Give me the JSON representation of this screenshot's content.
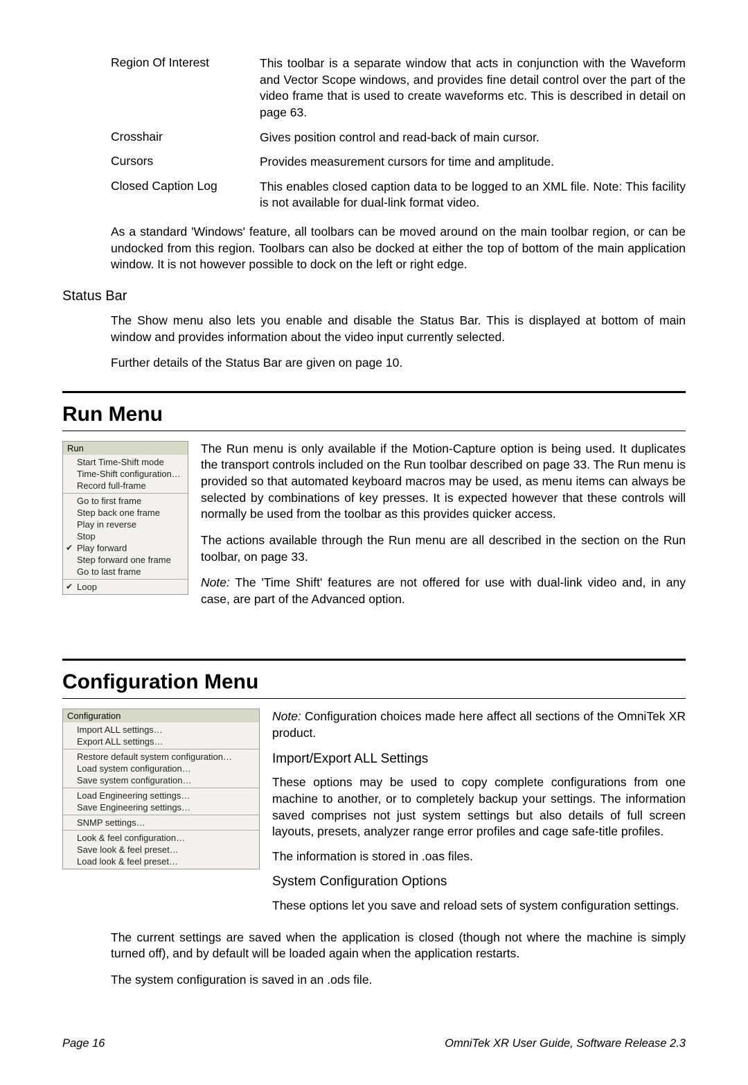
{
  "toolbars": [
    {
      "label": "Region Of Interest",
      "desc": "This toolbar is a separate window that acts in conjunction with the Waveform and Vector Scope windows, and provides fine detail control over the part of the video frame that is used to create waveforms etc. This is described in detail on page 63."
    },
    {
      "label": "Crosshair",
      "desc": "Gives position control and read-back of main cursor."
    },
    {
      "label": "Cursors",
      "desc": "Provides measurement cursors for time and amplitude."
    },
    {
      "label": "Closed Caption Log",
      "desc": "This enables closed caption data to be logged to an XML file. Note: This facility is not available for dual-link format video."
    }
  ],
  "toolbar_footer": "As a standard 'Windows' feature, all toolbars can be moved around on the main toolbar region, or can be undocked from this region. Toolbars can also be docked at either the top of bottom of the main application window. It is not however possible to dock on the left or right edge.",
  "status_heading": "Status Bar",
  "status_p1": "The Show menu also lets you enable and disable the Status Bar. This is displayed at bottom of main window and provides information about the video input currently selected.",
  "status_p2": "Further details of the Status Bar are given on page 10.",
  "run_heading": "Run Menu",
  "run_menu": {
    "title": "Run",
    "groups": [
      [
        "Start Time-Shift mode",
        "Time-Shift configuration…",
        "Record full-frame"
      ],
      [
        "Go to first frame",
        "Step back one frame",
        "Play in reverse",
        "Stop",
        "Play forward",
        "Step forward one frame",
        "Go to last frame"
      ],
      [
        "Loop"
      ]
    ],
    "checked": [
      "Play forward",
      "Loop"
    ]
  },
  "run_p1": "The Run menu is only available if the Motion-Capture option is being used. It duplicates the transport controls included on the Run toolbar described on page 33. The Run menu is provided so that automated keyboard macros may be used, as menu items can always be selected by combinations of key presses. It is expected however that these controls will normally be used from the toolbar as this provides quicker access.",
  "run_p2": "The actions available through the Run menu are all described in the section on the Run toolbar, on page 33.",
  "run_note_label": "Note:",
  "run_note": " The 'Time Shift' features are not offered for use with dual-link video and, in any case, are part of the Advanced option.",
  "config_heading": "Configuration Menu",
  "config_menu": {
    "title": "Configuration",
    "groups": [
      [
        "Import ALL settings…",
        "Export ALL settings…"
      ],
      [
        "Restore default system configuration…",
        "Load system configuration…",
        "Save system configuration…"
      ],
      [
        "Load Engineering settings…",
        "Save Engineering settings…"
      ],
      [
        "SNMP settings…"
      ],
      [
        "Look & feel configuration…",
        "Save look & feel preset…",
        "Load look & feel preset…"
      ]
    ]
  },
  "config_note_label": "Note:",
  "config_note": " Configuration choices made here affect all sections of the OmniTek XR product.",
  "config_sub1": "Import/Export ALL Settings",
  "config_p1": "These options may be used to copy complete configurations from one machine to another, or to completely backup your settings. The information saved comprises not just system settings but also details of full screen layouts, presets, analyzer range error profiles and cage safe-title profiles.",
  "config_p2": "The information is stored in .oas files.",
  "config_sub2": "System Configuration Options",
  "config_p3": "These options let you save and reload sets of system configuration settings.",
  "config_p4": "The current settings are saved when the application is closed (though not where the machine is simply turned off), and by default will be loaded again when the application restarts.",
  "config_p5": "The system configuration is saved in an .ods file.",
  "footer_left": "Page 16",
  "footer_right": "OmniTek XR User Guide, Software Release 2.3"
}
